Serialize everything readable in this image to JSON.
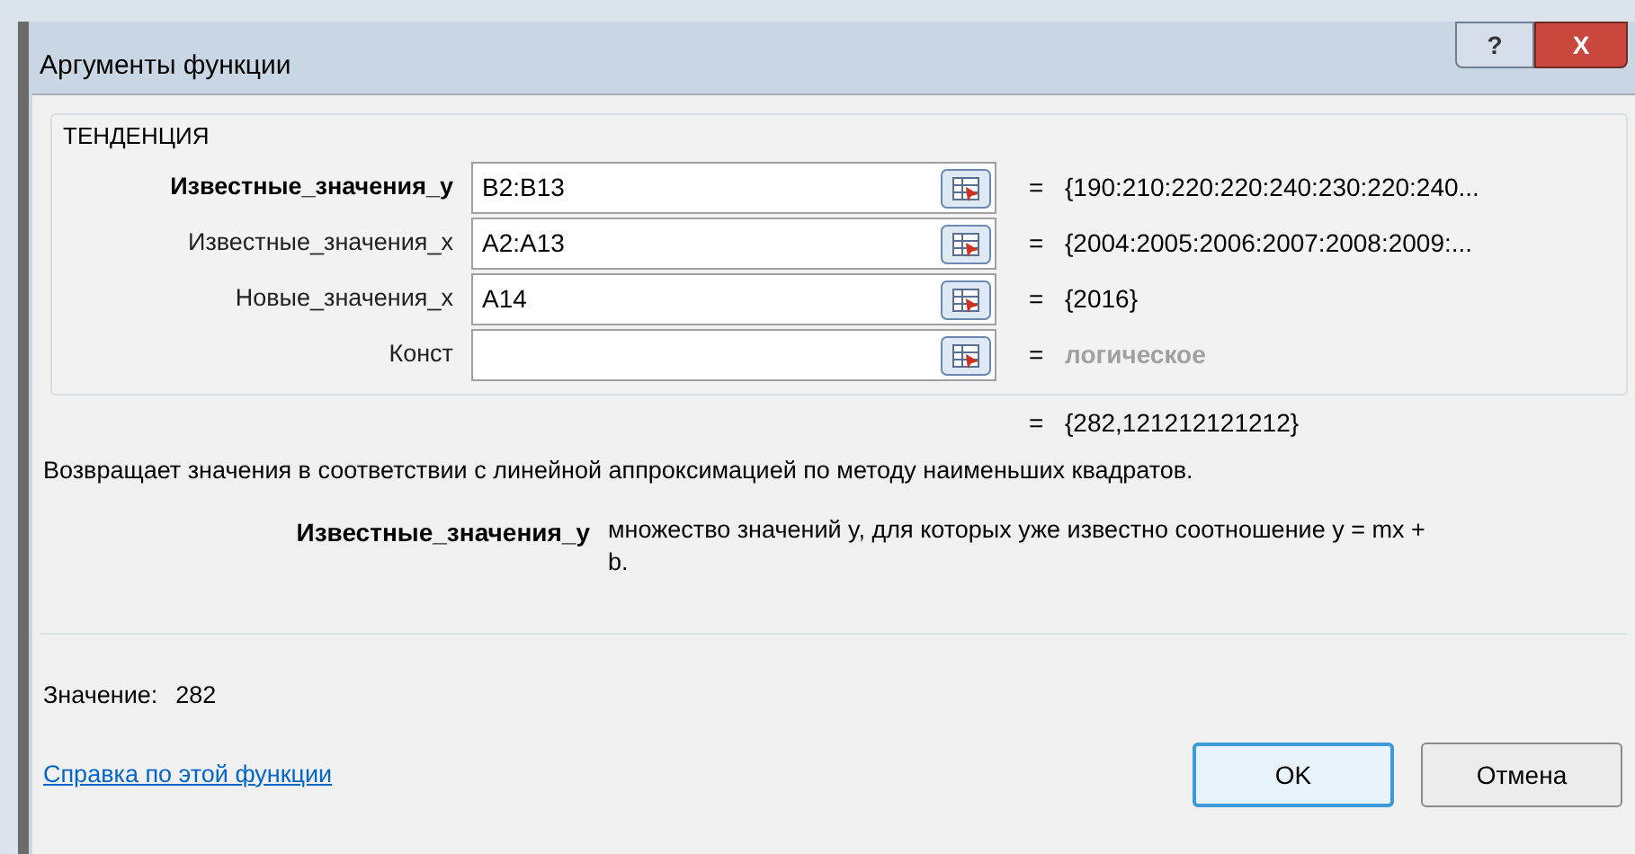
{
  "window": {
    "title": "Аргументы функции",
    "buttons": [
      "?",
      "X"
    ]
  },
  "function_name": "ТЕНДЕНЦИЯ",
  "arguments": [
    {
      "label": "Известные_значения_y",
      "value": "B2:B13",
      "result": "{190:210:220:220:240:230:220:240...",
      "selected": true,
      "result_is_type_hint": false
    },
    {
      "label": "Известные_значения_x",
      "value": "A2:A13",
      "result": "{2004:2005:2006:2007:2008:2009:...",
      "selected": false,
      "result_is_type_hint": false
    },
    {
      "label": "Новые_значения_x",
      "value": "A14",
      "result": "{2016}",
      "selected": false,
      "result_is_type_hint": false
    },
    {
      "label": "Конст",
      "result": "логическое",
      "selected": false,
      "result_is_type_hint": true
    }
  ],
  "equals": "=",
  "function_result": "{282,121212121212}",
  "description": "Возвращает значения в соответствии с линейной аппроксимацией по методу наименьших квадратов.",
  "argument_help": {
    "name": "Известные_значения_y",
    "text": "множество значений y, для которых уже известно соотношение y = mx + b."
  },
  "value_label": "Значение:",
  "value": "282",
  "help_link": "Справка по этой функции",
  "buttons": [
    {
      "label": "OK",
      "default": true
    },
    {
      "label": "Отмена",
      "default": false
    }
  ]
}
